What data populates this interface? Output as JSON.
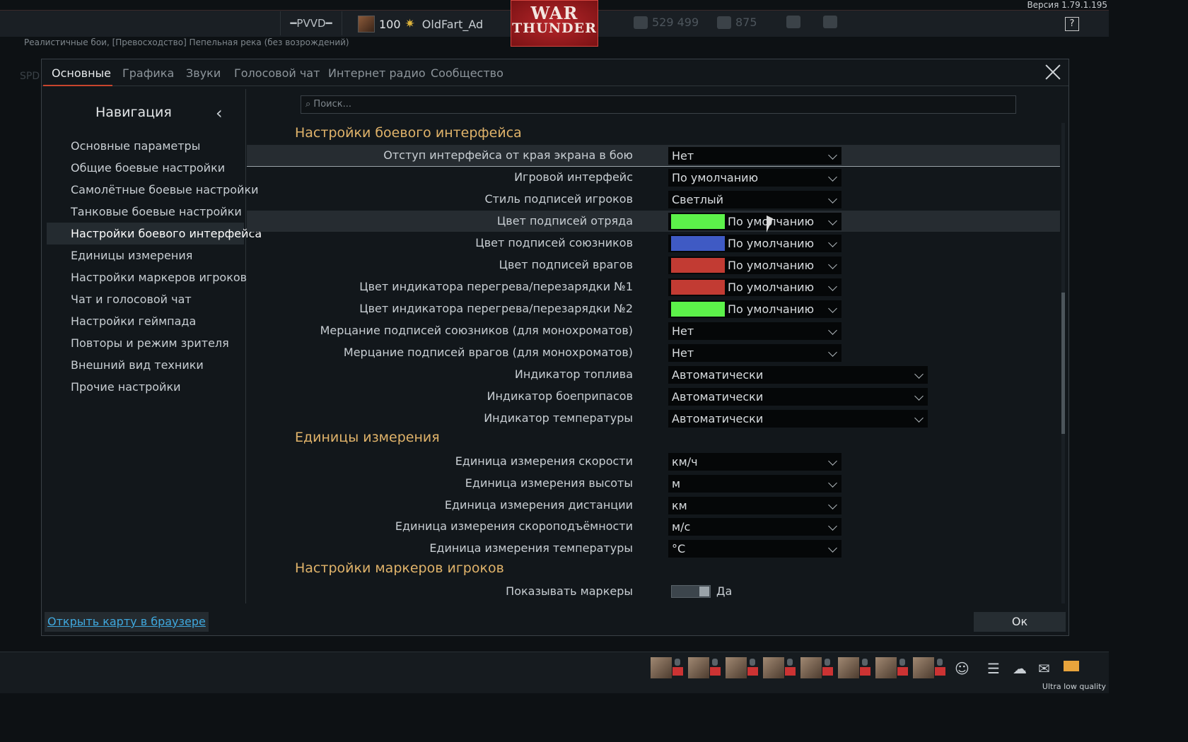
{
  "version": "Версия 1.79.1.195",
  "topbar": {
    "rank": "━PVVD━",
    "level": "100",
    "nickname": "OldFart_Ad",
    "logo_line1": "WAR",
    "logo_line2": "THUNDER",
    "silver_lions": "529 499",
    "golden_eagles": "875",
    "help": "?"
  },
  "battle_mode": "Реалистичные бои, [Превосходство] Пепельная река (без возрождений)",
  "bg_text": "SPD",
  "tabs": [
    "Основные",
    "Графика",
    "Звуки",
    "Голосовой чат",
    "Интернет радио",
    "Сообщество"
  ],
  "nav": {
    "title": "Навигация",
    "items": [
      "Основные параметры",
      "Общие боевые настройки",
      "Самолётные боевые настройки",
      "Танковые боевые настройки",
      "Настройки боевого интерфейса",
      "Единицы измерения",
      "Настройки маркеров игроков",
      "Чат и голосовой чат",
      "Настройки геймпада",
      "Повторы и режим зрителя",
      "Внешний вид техники",
      "Прочие настройки"
    ]
  },
  "search": {
    "placeholder": "⌕ Поиск..."
  },
  "sections": {
    "hud": "Настройки боевого интерфейса",
    "units": "Единицы измерения",
    "markers": "Настройки маркеров игроков"
  },
  "hud_rows": [
    {
      "label": "Отступ интерфейса от края экрана в бою",
      "value": "Нет"
    },
    {
      "label": "Игровой интерфейс",
      "value": "По умолчанию"
    },
    {
      "label": "Стиль подписей игроков",
      "value": "Светлый"
    },
    {
      "label": "Цвет подписей отряда",
      "value": "По умолчанию",
      "color": "#5cf24a"
    },
    {
      "label": "Цвет подписей союзников",
      "value": "По умолчанию",
      "color": "#3f5ac4"
    },
    {
      "label": "Цвет подписей врагов",
      "value": "По умолчанию",
      "color": "#c23b33"
    },
    {
      "label": "Цвет индикатора перегрева/перезарядки №1",
      "value": "По умолчанию",
      "color": "#c23b33"
    },
    {
      "label": "Цвет индикатора перегрева/перезарядки №2",
      "value": "По умолчанию",
      "color": "#5cf24a"
    },
    {
      "label": "Мерцание подписей союзников (для монохроматов)",
      "value": "Нет"
    },
    {
      "label": "Мерцание подписей врагов (для монохроматов)",
      "value": "Нет"
    },
    {
      "label": "Индикатор топлива",
      "value": "Автоматически"
    },
    {
      "label": "Индикатор боеприпасов",
      "value": "Автоматически"
    },
    {
      "label": "Индикатор температуры",
      "value": "Автоматически"
    }
  ],
  "unit_rows": [
    {
      "label": "Единица измерения скорости",
      "value": "км/ч"
    },
    {
      "label": "Единица измерения высоты",
      "value": "м"
    },
    {
      "label": "Единица измерения дистанции",
      "value": "км"
    },
    {
      "label": "Единица измерения скороподъёмности",
      "value": "м/с"
    },
    {
      "label": "Единица измерения температуры",
      "value": "°C"
    }
  ],
  "markers_row": {
    "label": "Показывать маркеры",
    "value": "Да"
  },
  "footer": {
    "open_map": "Открыть карту в браузере",
    "ok": "Ок"
  },
  "quality": "Ultra low quality",
  "colors": {
    "accent": "#c8452d",
    "section": "#e0b36a",
    "link": "#3fa8de"
  }
}
